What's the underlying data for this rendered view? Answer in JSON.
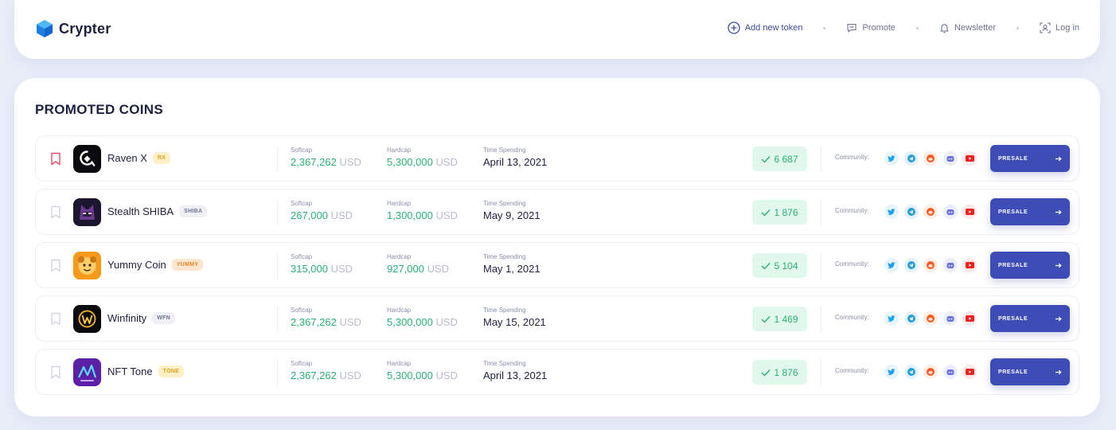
{
  "header": {
    "logo_text": "Crypter",
    "nav": [
      {
        "label": "Add new token",
        "icon": "plus-circle-icon"
      },
      {
        "label": "Promote",
        "icon": "chat-icon"
      },
      {
        "label": "Newsletter",
        "icon": "bell-icon"
      },
      {
        "label": "Log in",
        "icon": "user-scan-icon"
      }
    ]
  },
  "promoted": {
    "title": "PROMOTED COINS",
    "labels": {
      "softcap": "Softcap",
      "hardcap": "Hardcap",
      "time": "Time Spending",
      "community": "Community:",
      "presale": "PRESALE",
      "usd": "USD"
    },
    "rows": [
      {
        "name": "Raven X",
        "ticker": "RX",
        "softcap": "2,367,262",
        "hardcap": "5,300,000",
        "time": "April 13, 2021",
        "votes": "6 687",
        "bookmarked": true
      },
      {
        "name": "Stealth SHIBA",
        "ticker": "SHIBA",
        "softcap": "267,000",
        "hardcap": "1,300,000",
        "time": "May 9, 2021",
        "votes": "1 876",
        "bookmarked": false
      },
      {
        "name": "Yummy Coin",
        "ticker": "YUMMY",
        "softcap": "315,000",
        "hardcap": "927,000",
        "time": "May 1, 2021",
        "votes": "5 104",
        "bookmarked": false
      },
      {
        "name": "Winfinity",
        "ticker": "WFN",
        "softcap": "2,367,262",
        "hardcap": "5,300,000",
        "time": "May 15, 2021",
        "votes": "1 469",
        "bookmarked": false
      },
      {
        "name": "NFT Tone",
        "ticker": "TONE",
        "softcap": "2,367,262",
        "hardcap": "5,300,000",
        "time": "April 13, 2021",
        "votes": "1 876",
        "bookmarked": false
      }
    ]
  },
  "colors": {
    "accent": "#3e4db5",
    "green": "#2bb073",
    "bookmark_active": "#e04b62"
  }
}
